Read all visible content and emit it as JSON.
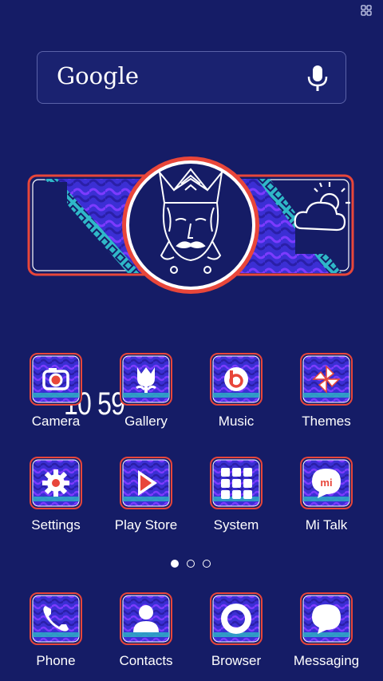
{
  "search": {
    "brand_text": "Google",
    "mic_icon": "microphone-icon"
  },
  "widget": {
    "time": "10 59",
    "weather_icon": "partly-cloudy-icon",
    "avatar_icon": "wayang-face-icon"
  },
  "colors": {
    "background": "#151c66",
    "tile_fill": "#3b2fd4",
    "accent": "#e8463a",
    "teal": "#2fb8c8"
  },
  "apps_row1": [
    {
      "label": "Camera",
      "icon": "camera-icon"
    },
    {
      "label": "Gallery",
      "icon": "tulip-icon"
    },
    {
      "label": "Music",
      "icon": "beats-icon"
    },
    {
      "label": "Themes",
      "icon": "pinwheel-icon"
    }
  ],
  "apps_row2": [
    {
      "label": "Settings",
      "icon": "gear-icon"
    },
    {
      "label": "Play Store",
      "icon": "play-icon"
    },
    {
      "label": "System",
      "icon": "folder-grid-icon"
    },
    {
      "label": "Mi Talk",
      "icon": "mi-chat-icon"
    }
  ],
  "dock": [
    {
      "label": "Phone",
      "icon": "phone-icon"
    },
    {
      "label": "Contacts",
      "icon": "person-icon"
    },
    {
      "label": "Browser",
      "icon": "ring-icon"
    },
    {
      "label": "Messaging",
      "icon": "speech-bubble-icon"
    }
  ],
  "pager": {
    "pages": 3,
    "current": 1
  }
}
